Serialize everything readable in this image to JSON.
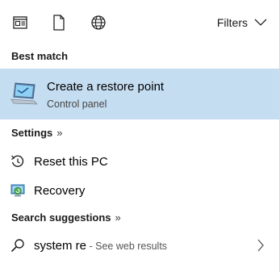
{
  "topbar": {
    "icons": [
      "apps-icon",
      "documents-icon",
      "web-icon"
    ],
    "filters_label": "Filters"
  },
  "sections": {
    "best_match": "Best match",
    "settings": "Settings",
    "settings_arrow": "»",
    "search_suggestions": "Search suggestions",
    "search_suggestions_arrow": "»"
  },
  "best_match_item": {
    "title": "Create a restore point",
    "subtitle": "Control panel",
    "icon": "restore-point-icon"
  },
  "settings_items": [
    {
      "label": "Reset this PC",
      "icon": "reset-icon"
    },
    {
      "label": "Recovery",
      "icon": "recovery-icon"
    }
  ],
  "suggestion": {
    "query": "system re",
    "hint": " - See web results",
    "icon": "search-icon"
  },
  "colors": {
    "highlight": "#c5ddf1",
    "text": "#000000",
    "secondary_text": "#444444"
  }
}
